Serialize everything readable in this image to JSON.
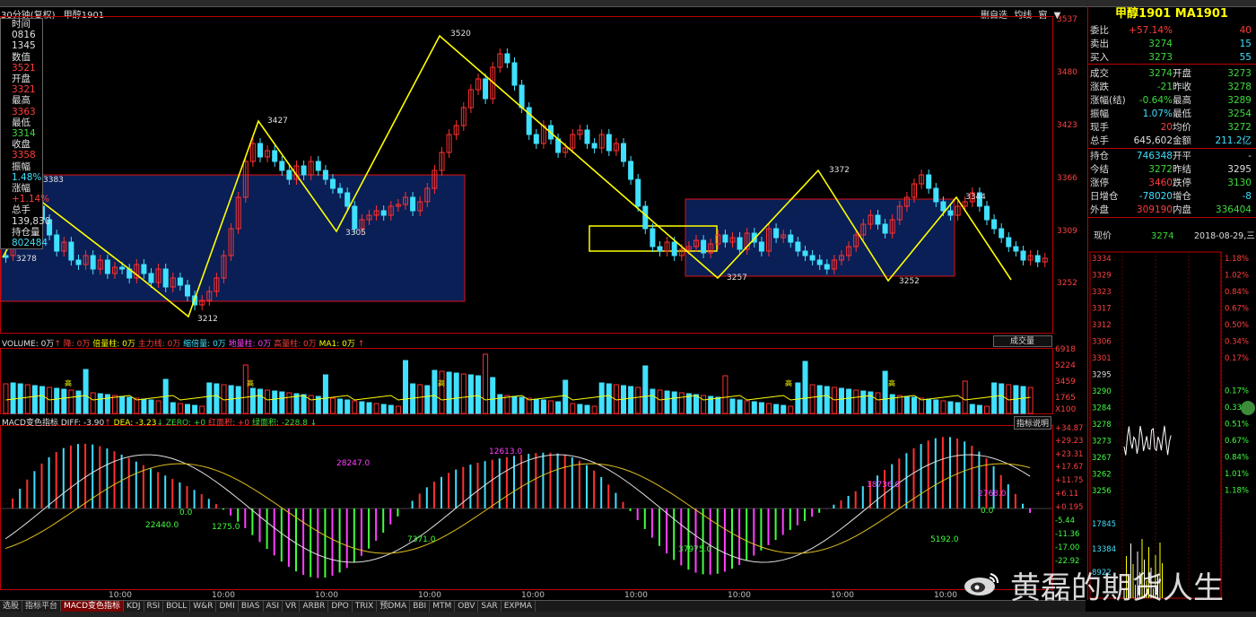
{
  "header": {
    "period": "30分钟(复权)",
    "symbol": "甲醇1901",
    "buttons": [
      "删自选",
      "均线",
      "窗",
      "▼"
    ]
  },
  "info_box": [
    {
      "text": "时间",
      "c": "wh"
    },
    {
      "text": "0816",
      "c": "wh"
    },
    {
      "text": "1345",
      "c": "wh"
    },
    {
      "text": "数值",
      "c": "wh"
    },
    {
      "text": "3521",
      "c": "rd"
    },
    {
      "text": "开盘",
      "c": "wh"
    },
    {
      "text": "3321",
      "c": "rd"
    },
    {
      "text": "最高",
      "c": "wh"
    },
    {
      "text": "3363",
      "c": "rd"
    },
    {
      "text": "最低",
      "c": "wh"
    },
    {
      "text": "3314",
      "c": "gr"
    },
    {
      "text": "收盘",
      "c": "wh"
    },
    {
      "text": "3358",
      "c": "rd"
    },
    {
      "text": "振幅",
      "c": "wh"
    },
    {
      "text": "1.48%",
      "c": "cy"
    },
    {
      "text": "涨幅",
      "c": "wh"
    },
    {
      "text": "+1.14%",
      "c": "rd"
    },
    {
      "text": "总手",
      "c": "wh"
    },
    {
      "text": "139,830",
      "c": "wh"
    },
    {
      "text": "持仓量",
      "c": "wh"
    },
    {
      "text": "802484",
      "c": "cy"
    }
  ],
  "price_axis": [
    "3537",
    "3480",
    "3423",
    "3366",
    "3309",
    "3252"
  ],
  "annotations": {
    "a3383": "3383",
    "a3278": "3278",
    "a3212": "3212",
    "a3427": "3427",
    "a3305": "3305",
    "a3520": "3520",
    "a3257": "3257",
    "a3372": "3372",
    "a3252": "3252",
    "a3344": "3344"
  },
  "volume": {
    "legend": [
      {
        "text": "VOLUME: 0万",
        "c": "wh"
      },
      {
        "text": "↑ 降: 0万",
        "c": "rd"
      },
      {
        "text": " 倍量柱: 0万",
        "c": "yl"
      },
      {
        "text": " 主力线: 0万",
        "c": "rd"
      },
      {
        "text": " 缩倍量: 0万",
        "c": "cy"
      },
      {
        "text": " 地量柱: 0万",
        "c": "mg"
      },
      {
        "text": " 高量柱: 0万",
        "c": "rd"
      },
      {
        "text": " MA1: 0万",
        "c": "yl"
      },
      {
        "text": " ↑",
        "c": "rd"
      }
    ],
    "dropdown": "成交量",
    "axis": [
      "6918",
      "5224",
      "3459",
      "1765",
      "X100"
    ],
    "tag": "高"
  },
  "macd": {
    "legend": [
      {
        "text": "MACD变色指标 DIFF: -3.90",
        "c": "wh"
      },
      {
        "text": "↑",
        "c": "rd"
      },
      {
        "text": " DEA: -3.23",
        "c": "yl"
      },
      {
        "text": "↓",
        "c": "gr"
      },
      {
        "text": " ZERO: +0",
        "c": "gr"
      },
      {
        "text": " 红面积: +0",
        "c": "rd"
      },
      {
        "text": " 绿面积: -228.8",
        "c": "gr"
      },
      {
        "text": " ↓",
        "c": "gr"
      }
    ],
    "help": "指标说明",
    "axis": [
      "+34.87",
      "+29.23",
      "+23.31",
      "+17.67",
      "+11.75",
      "+6.11",
      "+0.195",
      "-5.44",
      "-11.36",
      "-17.00",
      "-22.92"
    ],
    "labels": {
      "l1": "28247.0",
      "l2": "12613.0",
      "l3": "18736.0",
      "l4": "2768.0",
      "l5": "22440.0",
      "l6": "1275.0",
      "l7": "7371.0",
      "l8": "37975.0",
      "l9": "5192.0",
      "l10": "0.0",
      "l11": "0.0"
    }
  },
  "time_labels": [
    "10:00",
    "10:00",
    "10:00",
    "10:00",
    "10:00",
    "10:00",
    "10:00",
    "10:00",
    "10:00"
  ],
  "tabs": [
    "选股",
    "指标平台",
    "MACD变色指标",
    "KDJ",
    "RSI",
    "BOLL",
    "W&R",
    "DMI",
    "BIAS",
    "ASI",
    "VR",
    "ARBR",
    "DPO",
    "TRIX",
    "预DMA",
    "BBI",
    "MTM",
    "OBV",
    "SAR",
    "EXPMA"
  ],
  "active_tab": "MACD变色指标",
  "right_panel": {
    "title": "甲醇1901 MA1901",
    "rows": [
      {
        "k1": "委比",
        "v1": "+57.14%",
        "c1": "rd",
        "k2": "",
        "v2": "40",
        "c2": "rd"
      },
      {
        "k1": "卖出",
        "v1": "3274",
        "c1": "gr",
        "k2": "",
        "v2": "15",
        "c2": "cy"
      },
      {
        "k1": "买入",
        "v1": "3273",
        "c1": "gr",
        "k2": "",
        "v2": "55",
        "c2": "cy"
      },
      {
        "k1": "成交",
        "v1": "3274",
        "c1": "gr",
        "k2": "开盘",
        "v2": "3273",
        "c2": "gr"
      },
      {
        "k1": "涨跌",
        "v1": "-21",
        "c1": "gr",
        "k2": "昨收",
        "v2": "3278",
        "c2": "gr"
      },
      {
        "k1": "涨幅(结)",
        "v1": "-0.64%",
        "c1": "gr",
        "k2": "最高",
        "v2": "3289",
        "c2": "gr"
      },
      {
        "k1": "振幅",
        "v1": "1.07%",
        "c1": "cy",
        "k2": "最低",
        "v2": "3254",
        "c2": "gr"
      },
      {
        "k1": "现手",
        "v1": "20",
        "c1": "rd",
        "k2": "均价",
        "v2": "3272",
        "c2": "gr"
      },
      {
        "k1": "总手",
        "v1": "645,602",
        "c1": "wh",
        "k2": "金额",
        "v2": "211.2亿",
        "c2": "cy"
      },
      {
        "k1": "持仓",
        "v1": "746348",
        "c1": "cy",
        "k2": "开平",
        "v2": "-",
        "c2": "wh"
      },
      {
        "k1": "今结",
        "v1": "3272",
        "c1": "gr",
        "k2": "昨结",
        "v2": "3295",
        "c2": "wh"
      },
      {
        "k1": "涨停",
        "v1": "3460",
        "c1": "rd",
        "k2": "跌停",
        "v2": "3130",
        "c2": "gr"
      },
      {
        "k1": "日增仓",
        "v1": "-78020",
        "c1": "cy",
        "k2": "增仓",
        "v2": "-8",
        "c2": "cy"
      },
      {
        "k1": "外盘",
        "v1": "309190",
        "c1": "rd",
        "k2": "内盘",
        "v2": "336404",
        "c2": "gr"
      }
    ],
    "price_label": "现价",
    "price_value": "3274",
    "date": "2018-08-29,三",
    "mini_left_axis": [
      "3334",
      "3329",
      "3323",
      "3317",
      "3312",
      "3306",
      "3301",
      "3295",
      "3290",
      "3284",
      "3278",
      "3273",
      "3267",
      "3262",
      "3256",
      "17845",
      "13384",
      "8922"
    ],
    "mini_right_axis": [
      "1.18%",
      "1.02%",
      "0.84%",
      "0.67%",
      "0.50%",
      "0.34%",
      "0.17%",
      "0.17%",
      "0.33%",
      "0.51%",
      "0.67%",
      "0.84%",
      "1.01%",
      "1.18%"
    ]
  },
  "watermark": "黄磊的期货人生"
}
